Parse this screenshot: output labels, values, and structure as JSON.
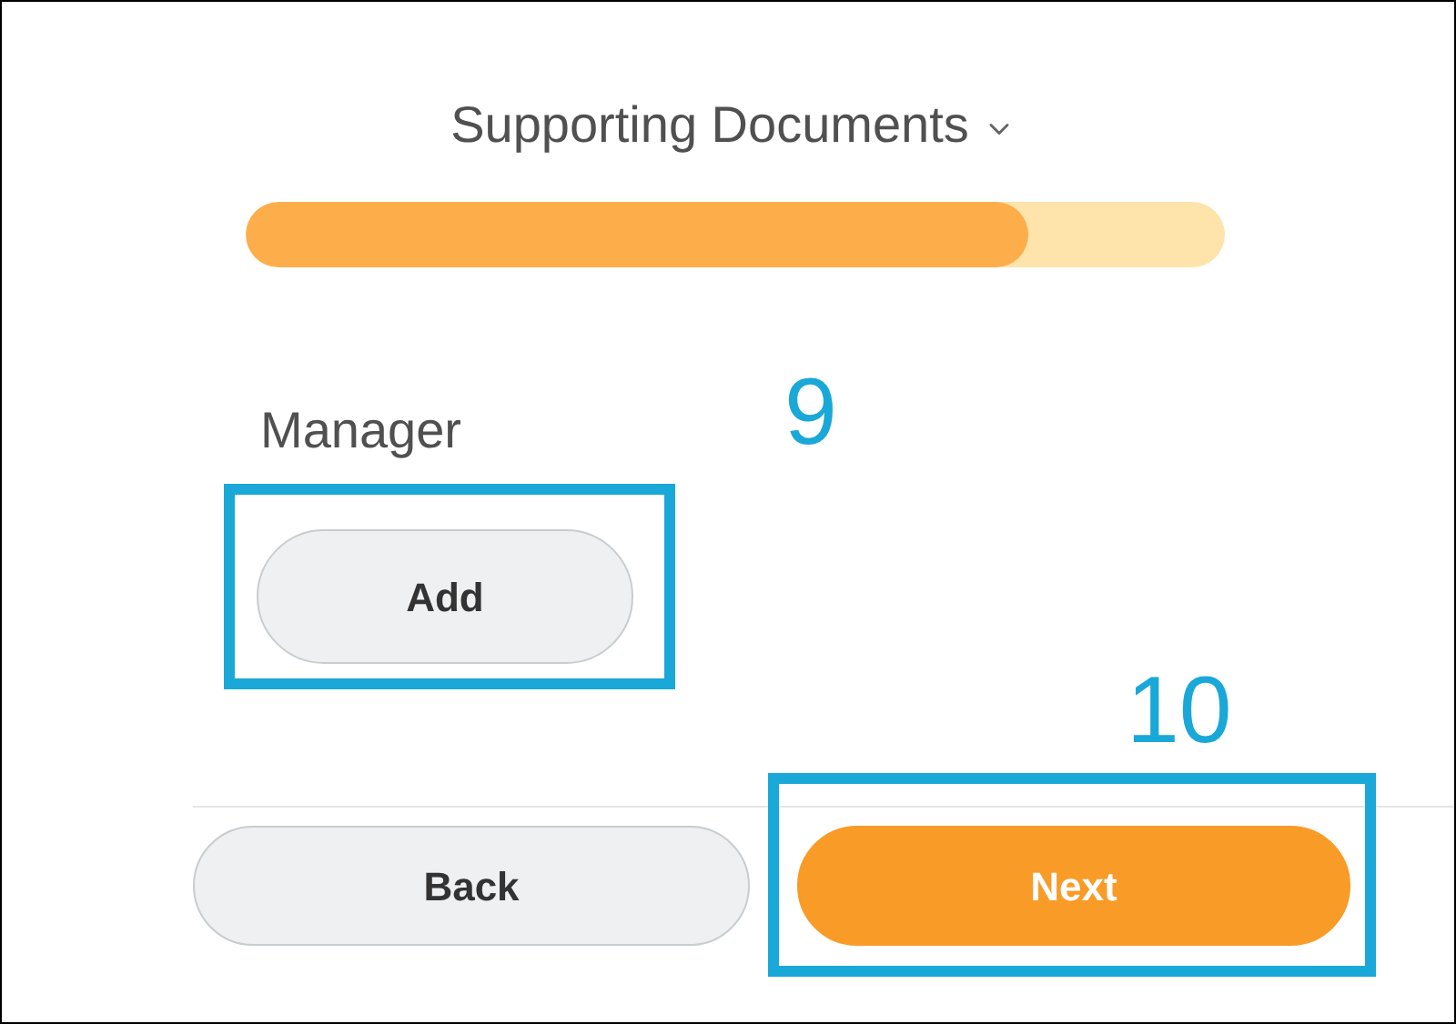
{
  "title": "Supporting Documents",
  "progress": {
    "level": 0.8
  },
  "field": {
    "label": "Manager",
    "button": "Add"
  },
  "footer": {
    "buttons": [
      {
        "label": "Back",
        "kind": "secondary"
      },
      {
        "label": "Next",
        "kind": "primary"
      }
    ]
  },
  "annotations": [
    {
      "label": "9"
    },
    {
      "label": "10"
    }
  ]
}
